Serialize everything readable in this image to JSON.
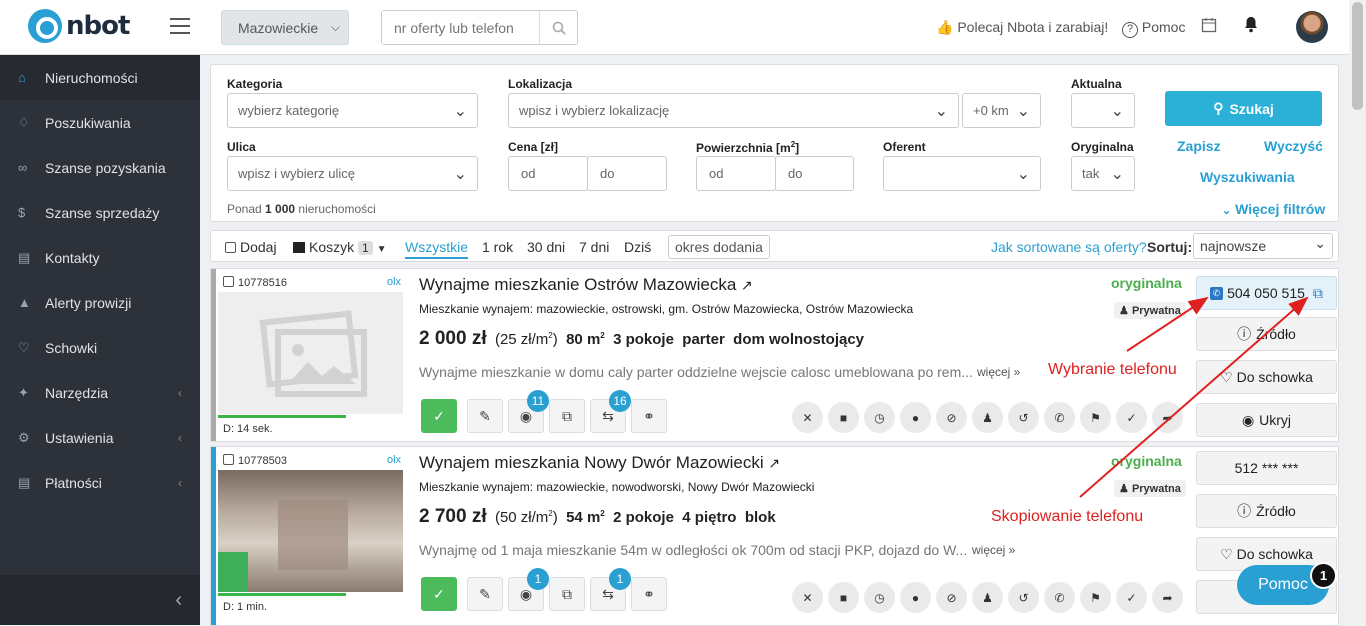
{
  "app": {
    "logo_text": "nbot"
  },
  "topbar": {
    "region": "Mazowieckie",
    "search_placeholder": "nr oferty lub telefon",
    "recommend": "Polecaj Nbota i zarabiaj!",
    "help": "Pomoc"
  },
  "sidebar": {
    "items": [
      {
        "label": "Nieruchomości",
        "icon": "home-icon"
      },
      {
        "label": "Poszukiwania",
        "icon": "bell-icon"
      },
      {
        "label": "Szanse pozyskania",
        "icon": "handshake-icon"
      },
      {
        "label": "Szanse sprzedaży",
        "icon": "dollar-icon"
      },
      {
        "label": "Kontakty",
        "icon": "contacts-icon"
      },
      {
        "label": "Alerty prowizji",
        "icon": "warning-icon"
      },
      {
        "label": "Schowki",
        "icon": "heart-icon"
      },
      {
        "label": "Narzędzia",
        "icon": "wrench-icon"
      },
      {
        "label": "Ustawienia",
        "icon": "gear-icon"
      },
      {
        "label": "Płatności",
        "icon": "cart-icon"
      }
    ]
  },
  "filters": {
    "kategoria_label": "Kategoria",
    "kategoria_placeholder": "wybierz kategorię",
    "lokalizacja_label": "Lokalizacja",
    "lokalizacja_placeholder": "wpisz i wybierz lokalizację",
    "radius": "+0 km",
    "aktualna_label": "Aktualna",
    "search_button": "Szukaj",
    "ulica_label": "Ulica",
    "ulica_placeholder": "wpisz i wybierz ulicę",
    "cena_label": "Cena [zł]",
    "powierzchnia_label": "Powierzchnia [m",
    "powierzchnia_sup": "2",
    "powierzchnia_close": "]",
    "from": "od",
    "to": "do",
    "oferent_label": "Oferent",
    "oryginalna_label": "Oryginalna",
    "oryginalna_value": "tak",
    "zapisz": "Zapisz",
    "wyczysc": "Wyczyść",
    "wyszukiwania": "Wyszukiwania",
    "wiecej": "Więcej filtrów",
    "count_prefix": "Ponad",
    "count_value": "1 000",
    "count_suffix": "nieruchomości"
  },
  "toolbar": {
    "dodaj": "Dodaj",
    "koszyk": "Koszyk",
    "koszyk_count": "1",
    "tabs": [
      "Wszystkie",
      "1 rok",
      "30 dni",
      "7 dni",
      "Dziś"
    ],
    "period": "okres dodania",
    "sort_question": "Jak sortowane są oferty?",
    "sort_label": "Sortuj:",
    "sort_value": "najnowsze"
  },
  "listings": [
    {
      "id": "10778516",
      "source": "olx",
      "title": "Wynajme mieszkanie Ostrów Mazowiecka",
      "location": "Mieszkanie wynajem: mazowieckie, ostrowski, gm. Ostrów Mazowiecka, Ostrów Mazowiecka",
      "price": "2 000 zł",
      "per_m2": "(25 zł/m",
      "per_m2_close": ")",
      "area": "80 m",
      "rooms": "3 pokoje",
      "floor": "parter",
      "building": "dom wolnostojący",
      "description": "Wynajme mieszkanie w domu caly parter oddzielne wejscie calosc umeblowana po rem...",
      "more": "więcej »",
      "original": "oryginalna",
      "owner": "Prywatna",
      "time": "D: 14 sek.",
      "phone": "504 050 515",
      "badge_a": "11",
      "badge_b": "16"
    },
    {
      "id": "10778503",
      "source": "olx",
      "title": "Wynajem mieszkania Nowy Dwór Mazowiecki",
      "location": "Mieszkanie wynajem: mazowieckie, nowodworski, Nowy Dwór Mazowiecki",
      "price": "2 700 zł",
      "per_m2": "(50 zł/m",
      "per_m2_close": ")",
      "area": "54 m",
      "rooms": "2 pokoje",
      "floor": "4 piętro",
      "building": "blok",
      "description": "Wynajmę od 1 maja mieszkanie 54m w odległości ok 700m od stacji PKP, dojazd do W...",
      "more": "więcej »",
      "original": "oryginalna",
      "owner": "Prywatna",
      "time": "D: 1 min.",
      "phone": "512 *** ***",
      "badge_a": "1",
      "badge_b": "1"
    }
  ],
  "right_buttons": {
    "zrodlo": "Źródło",
    "schowek": "Do schowka",
    "ukryj": "Ukryj"
  },
  "annotations": {
    "call": "Wybranie telefonu",
    "copy": "Skopiowanie telefonu"
  },
  "help_widget": {
    "label": "Pomoc",
    "badge": "1"
  }
}
